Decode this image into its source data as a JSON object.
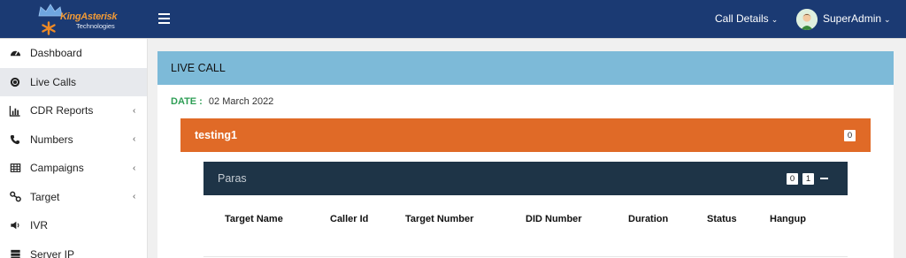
{
  "brand": {
    "name": "KingAsterisk",
    "sub": "Technologies"
  },
  "header": {
    "call_details": "Call Details",
    "user_name": "SuperAdmin"
  },
  "sidebar": {
    "items": [
      {
        "label": "Dashboard",
        "icon": "dashboard-icon"
      },
      {
        "label": "Live Calls",
        "icon": "live-calls-icon"
      },
      {
        "label": "CDR Reports",
        "icon": "bar-chart-icon"
      },
      {
        "label": "Numbers",
        "icon": "phone-icon"
      },
      {
        "label": "Campaigns",
        "icon": "table-icon"
      },
      {
        "label": "Target",
        "icon": "target-icon"
      },
      {
        "label": "IVR",
        "icon": "volume-icon"
      },
      {
        "label": "Server IP",
        "icon": "server-icon"
      }
    ]
  },
  "main": {
    "panel_title": "LIVE CALL",
    "date_label": "DATE :",
    "date_value": "02 March 2022",
    "campaign": {
      "title": "testing1",
      "count": "0"
    },
    "target": {
      "title": "Paras",
      "count_a": "0",
      "count_b": "1"
    },
    "columns": [
      "Target Name",
      "Caller Id",
      "Target Number",
      "DID Number",
      "Duration",
      "Status",
      "Hangup"
    ]
  },
  "colors": {
    "topbar": "#1b3a73",
    "panel_head": "#7dbad8",
    "campaign_bar": "#e06a27",
    "target_bar": "#1e3447",
    "date_label": "#2e9e55"
  }
}
